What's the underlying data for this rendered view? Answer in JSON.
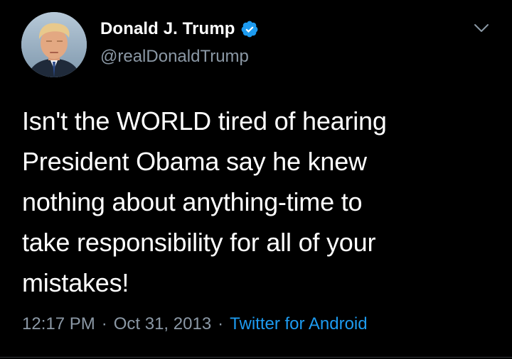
{
  "tweet": {
    "author": {
      "display_name": "Donald J. Trump",
      "handle": "@realDonaldTrump",
      "verified": true,
      "avatar_icon": "profile-photo"
    },
    "text": "Isn't the WORLD tired of hearing\nPresident Obama say he knew\nnothing about anything-time to\ntake responsibility for all of your\nmistakes!",
    "time": "12:17 PM",
    "date": "Oct 31, 2013",
    "separator": "·",
    "source": "Twitter for Android",
    "menu_icon": "chevron-down-icon"
  },
  "colors": {
    "background": "#000000",
    "primary_text": "#ffffff",
    "secondary_text": "#8b98a5",
    "accent": "#1d9bf0"
  }
}
